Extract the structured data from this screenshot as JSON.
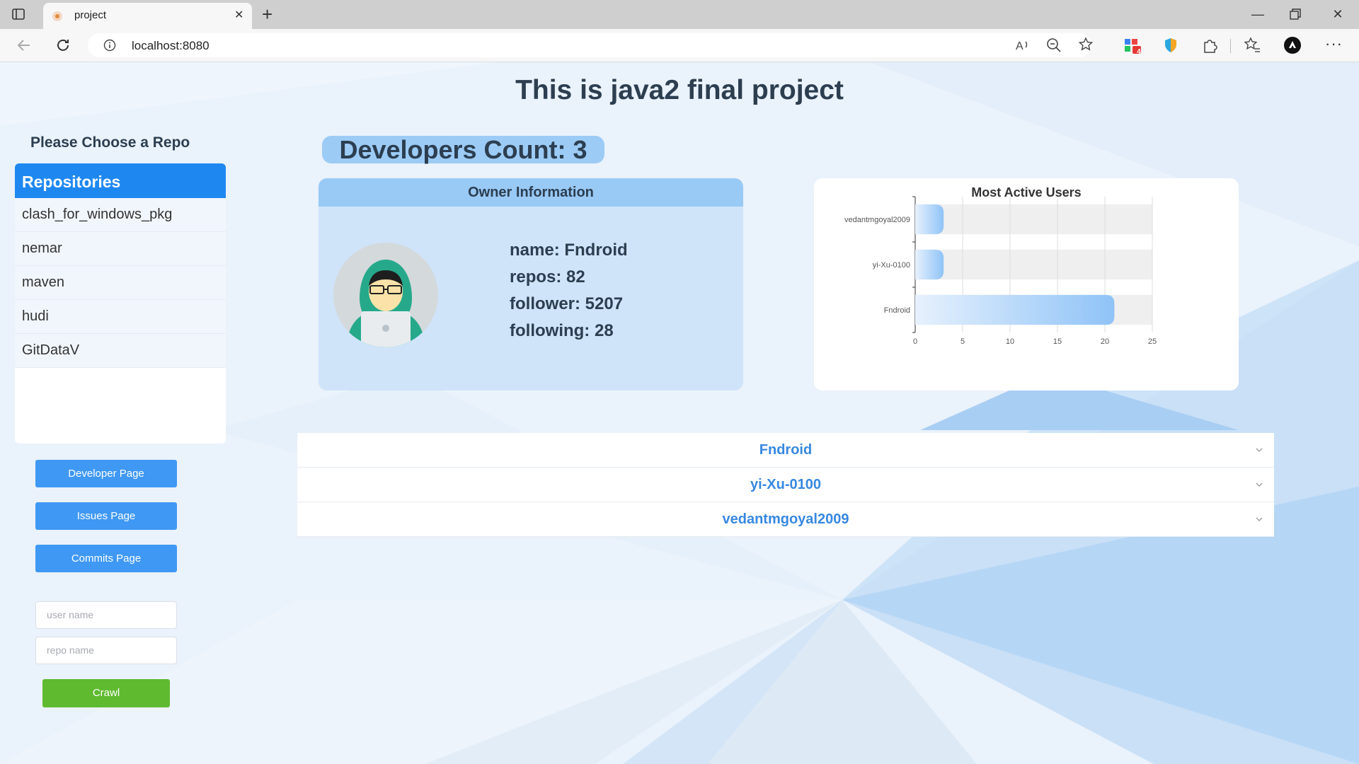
{
  "browser": {
    "tab_title": "project",
    "url": "localhost:8080",
    "badge_count": "4"
  },
  "page": {
    "title": "This is java2 final project"
  },
  "sidebar": {
    "choose_label": "Please Choose a Repo",
    "repo_header": "Repositories",
    "repos": [
      "clash_for_windows_pkg",
      "nemar",
      "maven",
      "hudi",
      "GitDataV"
    ],
    "buttons": {
      "developer": "Developer Page",
      "issues": "Issues Page",
      "commits": "Commits Page",
      "crawl": "Crawl"
    },
    "inputs": {
      "user_placeholder": "user name",
      "repo_placeholder": "repo name"
    }
  },
  "developers": {
    "count_label": "Developers Count: 3"
  },
  "owner": {
    "header": "Owner Information",
    "name": "name: Fndroid",
    "repos": "repos: 82",
    "follower": "follower: 5207",
    "following": "following: 28"
  },
  "chart_data": {
    "type": "bar",
    "orientation": "horizontal",
    "title": "Most Active Users",
    "categories": [
      "vedantmgoyal2009",
      "yi-Xu-0100",
      "Fndroid"
    ],
    "values": [
      3,
      3,
      21
    ],
    "xlim": [
      0,
      25
    ],
    "xticks": [
      0,
      5,
      10,
      15,
      20,
      25
    ],
    "grid": true,
    "legend": "none"
  },
  "collapse_items": [
    "Fndroid",
    "yi-Xu-0100",
    "vedantmgoyal2009"
  ],
  "colors": {
    "primary": "#3f98f3",
    "success": "#5fba2f",
    "link": "#3788e0",
    "card": "#cfe4f9"
  }
}
